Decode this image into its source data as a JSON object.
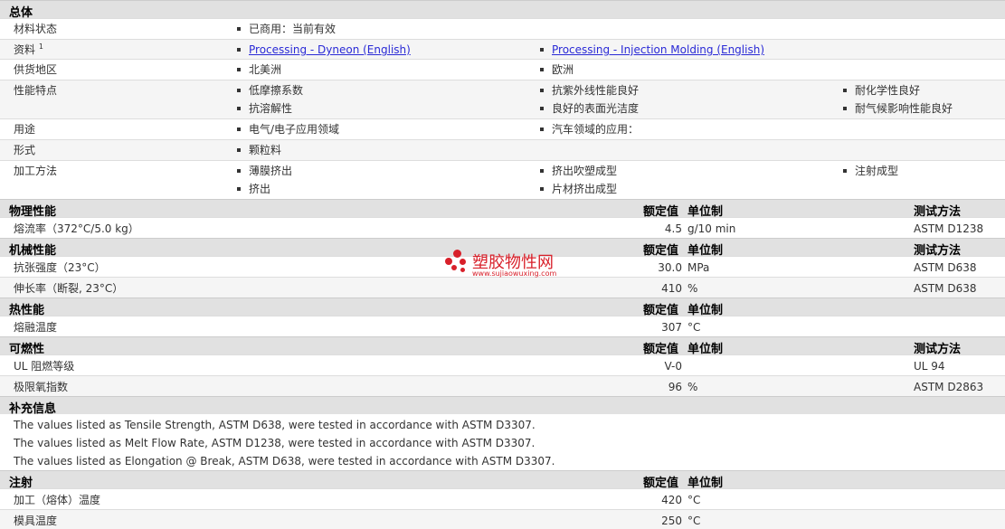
{
  "general": {
    "title": "总体",
    "material_status": {
      "label": "材料状态",
      "values": [
        "已商用：当前有效"
      ]
    },
    "literature": {
      "label": "资料",
      "sup": "1",
      "links": [
        "Processing - Dyneon (English)",
        "Processing - Injection Molding (English)"
      ]
    },
    "availability": {
      "label": "供货地区",
      "values": [
        "北美洲",
        "欧洲"
      ]
    },
    "features": {
      "label": "性能特点",
      "values": [
        "低摩擦系数",
        "抗紫外线性能良好",
        "耐化学性良好",
        "抗溶解性",
        "良好的表面光洁度",
        "耐气候影响性能良好"
      ]
    },
    "uses": {
      "label": "用途",
      "values": [
        "电气/电子应用领域",
        "汽车领域的应用："
      ]
    },
    "forms": {
      "label": "形式",
      "values": [
        "颗粒料"
      ]
    },
    "processing": {
      "label": "加工方法",
      "values": [
        "薄膜挤出",
        "挤出吹塑成型",
        "注射成型",
        "挤出",
        "片材挤出成型"
      ]
    }
  },
  "headers": {
    "nominal": "额定值",
    "unit": "单位制",
    "method": "测试方法"
  },
  "physical": {
    "title": "物理性能",
    "rows": [
      {
        "name": "熔流率（372°C/5.0 kg）",
        "value": "4.5",
        "unit": "g/10 min",
        "method": "ASTM D1238"
      }
    ]
  },
  "mechanical": {
    "title": "机械性能",
    "rows": [
      {
        "name": "抗张强度（23°C）",
        "value": "30.0",
        "unit": "MPa",
        "method": "ASTM D638"
      },
      {
        "name": "伸长率（断裂, 23°C）",
        "value": "410",
        "unit": "%",
        "method": "ASTM D638"
      }
    ]
  },
  "thermal": {
    "title": "热性能",
    "rows": [
      {
        "name": "熔融温度",
        "value": "307",
        "unit": "°C",
        "method": ""
      }
    ]
  },
  "flammability": {
    "title": "可燃性",
    "rows": [
      {
        "name": "UL 阻燃等级",
        "value": "V-0",
        "unit": "",
        "method": "UL 94"
      },
      {
        "name": "极限氧指数",
        "value": "96",
        "unit": "%",
        "method": "ASTM D2863"
      }
    ]
  },
  "additional": {
    "title": "补充信息",
    "notes": [
      "The values listed as Tensile Strength, ASTM D638, were tested in accordance with ASTM D3307.",
      "The values listed as Melt Flow Rate, ASTM D1238, were tested in accordance with ASTM D3307.",
      "The values listed as Elongation @ Break, ASTM D638, were tested in accordance with ASTM D3307."
    ]
  },
  "injection": {
    "title": "注射",
    "rows": [
      {
        "name": "加工（熔体）温度",
        "value": "420",
        "unit": "°C"
      },
      {
        "name": "模具温度",
        "value": "250",
        "unit": "°C"
      }
    ]
  },
  "watermark": {
    "name": "塑胶物性网",
    "url": "www.sujiaowuxing.com"
  },
  "colors": {
    "header_bg": "#e1e1e1",
    "link": "#2a2ad6",
    "watermark": "#d8202a"
  }
}
